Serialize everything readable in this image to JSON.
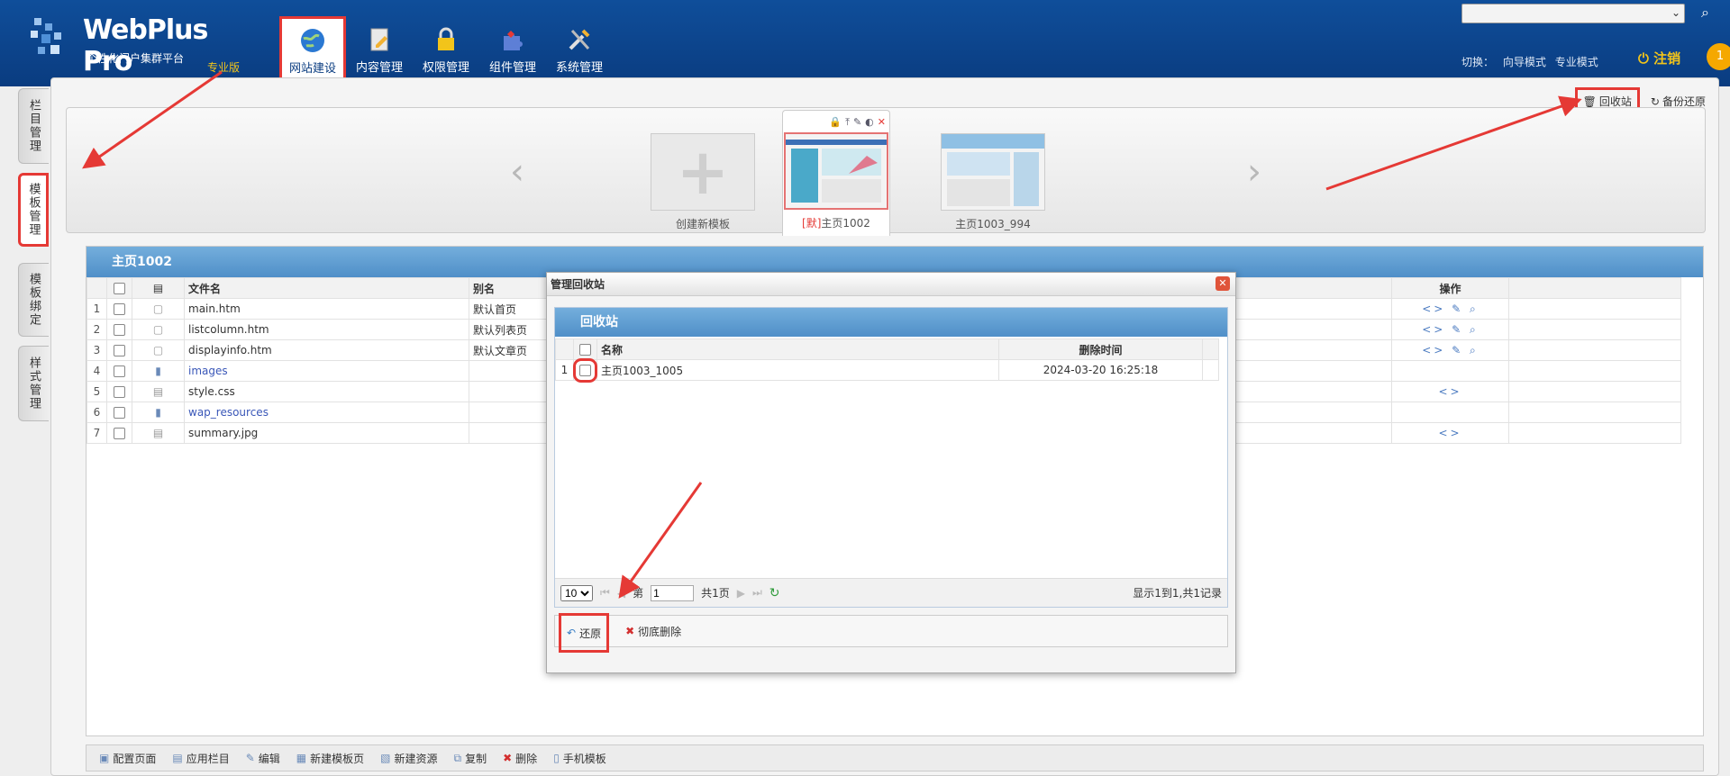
{
  "header": {
    "logo_title": "WebPlus Pro",
    "logo_subtitle": "个性化门户集群平台",
    "logo_edition": "专业版",
    "nav": [
      {
        "label": "网站建设",
        "icon": "globe-icon"
      },
      {
        "label": "内容管理",
        "icon": "document-edit-icon"
      },
      {
        "label": "权限管理",
        "icon": "lock-icon"
      },
      {
        "label": "组件管理",
        "icon": "puzzle-icon"
      },
      {
        "label": "系统管理",
        "icon": "tools-icon"
      }
    ],
    "mode_switch_label": "切换：",
    "mode_guide": "向导模式",
    "mode_pro": "专业模式",
    "logout": "注销",
    "badge": "1"
  },
  "side_tabs": [
    "栏目管理",
    "模板管理",
    "模板绑定",
    "样式管理"
  ],
  "top_actions": {
    "recycle": "回收站",
    "backup": "备份还原"
  },
  "templates": [
    {
      "label": "创建新模板"
    },
    {
      "default_tag": "[默]",
      "label": "主页1002"
    },
    {
      "label": "主页1003_994"
    }
  ],
  "file_panel": {
    "title": "主页1002",
    "columns": {
      "filename": "文件名",
      "alias": "别名",
      "ops": "操作"
    },
    "rows": [
      {
        "num": "1",
        "name": "main.htm",
        "alias": "默认首页",
        "ops": "<> ✎ ⌕"
      },
      {
        "num": "2",
        "name": "listcolumn.htm",
        "alias": "默认列表页",
        "ops": "<> ✎ ⌕"
      },
      {
        "num": "3",
        "name": "displayinfo.htm",
        "alias": "默认文章页",
        "ops": "<> ✎ ⌕"
      },
      {
        "num": "4",
        "name": "images",
        "alias": "",
        "ops": ""
      },
      {
        "num": "5",
        "name": "style.css",
        "alias": "",
        "ops": "<>"
      },
      {
        "num": "6",
        "name": "wap_resources",
        "alias": "",
        "ops": ""
      },
      {
        "num": "7",
        "name": "summary.jpg",
        "alias": "",
        "ops": "<>"
      }
    ]
  },
  "bottom_toolbar": [
    "配置页面",
    "应用栏目",
    "编辑",
    "新建模板页",
    "新建资源",
    "复制",
    "删除",
    "手机模板"
  ],
  "modal": {
    "title": "管理回收站",
    "panel_title": "回收站",
    "col_name": "名称",
    "col_time": "删除时间",
    "rows": [
      {
        "num": "1",
        "name": "主页1003_1005",
        "time": "2024-03-20 16:25:18"
      }
    ],
    "pager": {
      "size": "10",
      "page_prefix": "第",
      "page": "1",
      "page_suffix": "共1页",
      "summary": "显示1到1,共1记录"
    },
    "restore": "还原",
    "delete": "彻底删除"
  }
}
